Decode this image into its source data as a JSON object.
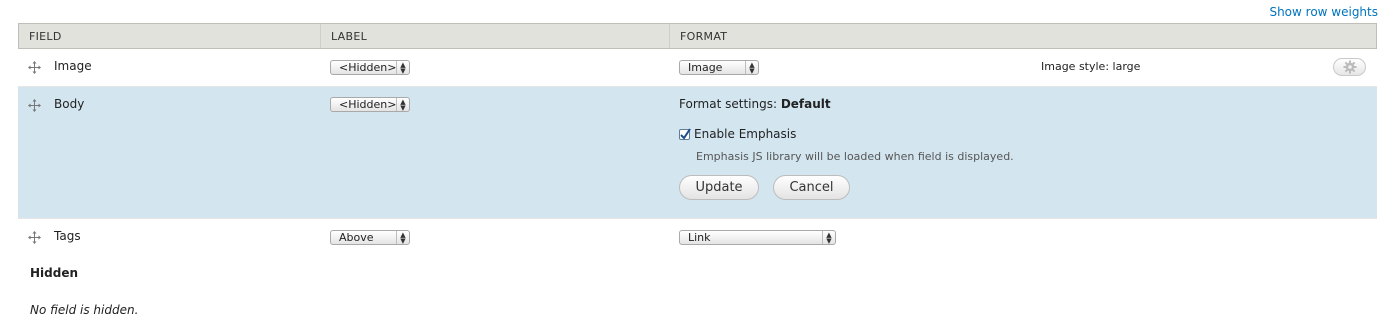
{
  "header_link": {
    "show_row_weights": "Show row weights"
  },
  "table": {
    "columns": [
      "FIELD",
      "LABEL",
      "FORMAT"
    ],
    "rows": [
      {
        "field": "Image",
        "label_select": "<Hidden>",
        "format_select": "Image",
        "summary": "Image style: large",
        "settings_icon": "gear-icon"
      },
      {
        "field": "Body",
        "label_select": "<Hidden>",
        "format_settings": {
          "title_prefix": "Format settings:",
          "title_value": "Default",
          "checkbox_label": "Enable Emphasis",
          "checkbox_checked": true,
          "description": "Emphasis JS library will be loaded when field is displayed.",
          "update_label": "Update",
          "cancel_label": "Cancel"
        }
      },
      {
        "field": "Tags",
        "label_select": "Above",
        "format_select": "Link"
      }
    ]
  },
  "hidden_section": {
    "title": "Hidden",
    "empty_text": "No field is hidden."
  },
  "colors": {
    "link": "#0074bd",
    "header_bg": "#e1e2dc",
    "highlight_row_bg": "#d3e6f0"
  }
}
